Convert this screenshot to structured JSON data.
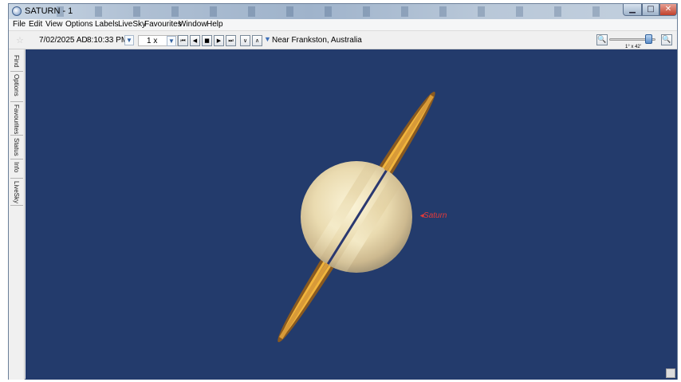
{
  "window": {
    "title": "SATURN - 1",
    "controls": {
      "minimize": "▁",
      "maximize": "□",
      "close": "✕"
    }
  },
  "menu": [
    "File",
    "Edit",
    "View",
    "Options",
    "Labels",
    "LiveSky",
    "Favourites",
    "Window",
    "Help"
  ],
  "toolbar": {
    "date": "7/02/2025 AD",
    "time": "8:10:33 PM",
    "speed": "1 x",
    "playback": [
      "⏮",
      "◀",
      "■",
      "▶",
      "⏭"
    ],
    "nav_down": "∨",
    "nav_up": "∧",
    "location": "Near Frankston, Australia",
    "zoom_out": "🔍",
    "zoom_in": "🔍",
    "field_of_view": "1° x 42'",
    "zoom_level": 0.85
  },
  "side_tabs": [
    "Find",
    "Options",
    "Favourites",
    "Status",
    "Info",
    "LiveSky"
  ],
  "sky": {
    "object_label": "◂Saturn",
    "colors": {
      "sky": "#233b6c",
      "label": "#e23a3a",
      "rings": "#c98a36"
    }
  },
  "icons": {
    "app": "planet-icon",
    "favourite": "star-icon",
    "location": "chevron-down-icon"
  }
}
